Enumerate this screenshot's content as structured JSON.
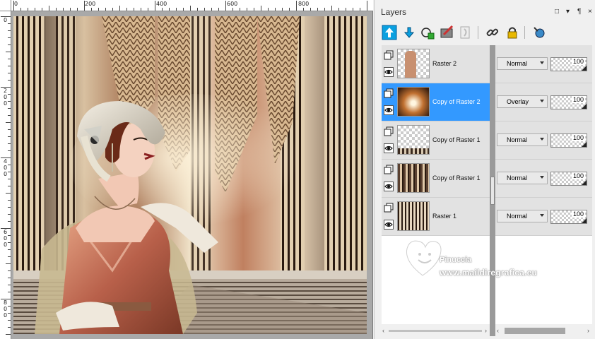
{
  "rulers": {
    "horizontal_labels": [
      "0",
      "200",
      "400",
      "600",
      "800"
    ],
    "vertical_labels": [
      "0",
      "200",
      "400",
      "600",
      "800"
    ]
  },
  "layers_panel": {
    "title": "Layers",
    "title_buttons": [
      "□",
      "▾",
      "¶",
      "×"
    ],
    "toolbar_icons": [
      "new-raster-layer-icon",
      "new-vector-layer-icon",
      "new-mask-layer-icon",
      "new-adjustment-layer-icon",
      "delete-layer-icon",
      "link-layers-icon",
      "lock-layer-icon",
      "layer-properties-icon"
    ],
    "layers": [
      {
        "name": "Raster 2",
        "blend_mode": "Normal",
        "opacity": "100",
        "selected": false,
        "thumb_color": "#c89070"
      },
      {
        "name": "Copy of Raster 2",
        "blend_mode": "Overlay",
        "opacity": "100",
        "selected": true,
        "thumb_color": "#c07030"
      },
      {
        "name": "Copy of Raster 1",
        "blend_mode": "Normal",
        "opacity": "100",
        "selected": false,
        "thumb_color": "#ffffff"
      },
      {
        "name": "Copy of Raster 1",
        "blend_mode": "Normal",
        "opacity": "100",
        "selected": false,
        "thumb_color": "#5a4030"
      },
      {
        "name": "Raster 1",
        "blend_mode": "Normal",
        "opacity": "100",
        "selected": false,
        "thumb_color": "#8a7058"
      }
    ]
  },
  "watermark": {
    "name": "Pinuccia",
    "url": "www.maildiregrafica.eu"
  },
  "colors": {
    "selection": "#3399ff",
    "panel_bg": "#f0f0f0",
    "canvas_bg": "#a9a9a9"
  }
}
